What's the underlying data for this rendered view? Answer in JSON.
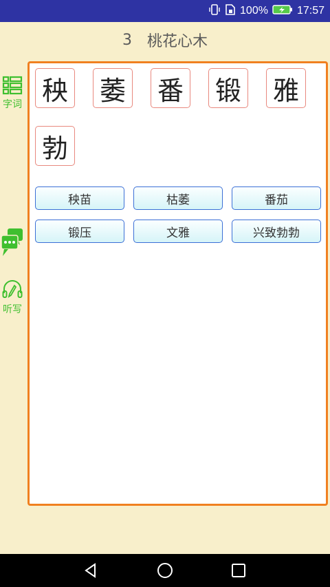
{
  "status_bar": {
    "battery": "100%",
    "time": "17:57"
  },
  "header": {
    "lesson_number": "3",
    "lesson_title": "桃花心木"
  },
  "side_nav": [
    {
      "label": "字词",
      "icon": "grid-list-icon"
    },
    {
      "label": "",
      "icon": "chat-bubbles-icon"
    },
    {
      "label": "听写",
      "icon": "headphones-pen-icon"
    }
  ],
  "characters": [
    "秧",
    "萎",
    "番",
    "锻",
    "雅",
    "勃"
  ],
  "words": [
    "秧苗",
    "枯萎",
    "番茄",
    "锻压",
    "文雅",
    "兴致勃勃"
  ],
  "colors": {
    "accent_green": "#3fbf2f",
    "panel_border": "#f08020",
    "char_border": "#e8887e",
    "word_border": "#3b6fd6",
    "status_bar": "#2e33a3"
  }
}
